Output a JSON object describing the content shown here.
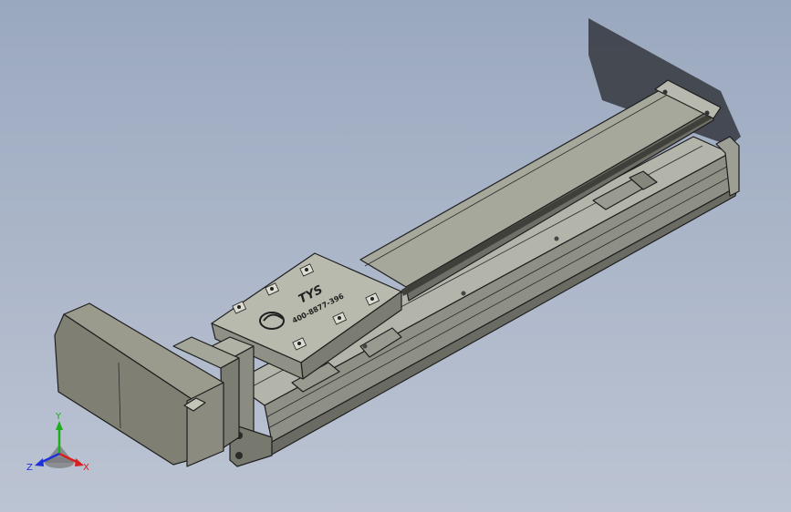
{
  "model": {
    "brand_text": "TYS",
    "phone_text": "400-8877-396"
  },
  "triad": {
    "x_label": "X",
    "y_label": "Y",
    "z_label": "Z",
    "x_color": "#d81e1e",
    "y_color": "#1cae1c",
    "z_color": "#1e32d8"
  },
  "colors": {
    "body_top": "#a9aa9e",
    "body_side": "#7c7d73",
    "body_dark": "#55564e",
    "motor": "#8d8e80",
    "shadow": "#3a3d45"
  }
}
